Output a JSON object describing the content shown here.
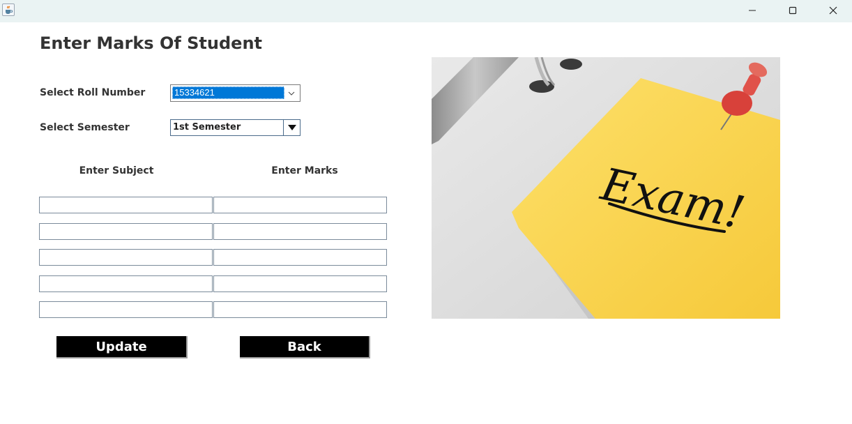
{
  "window": {
    "app_icon": "java-cup-icon",
    "controls": [
      "minimize-icon",
      "maximize-icon",
      "close-icon"
    ]
  },
  "form": {
    "title": "Enter Marks Of Student",
    "roll_label": "Select Roll Number",
    "roll_value": "15334621",
    "semester_label": "Select Semester",
    "semester_value": "1st Semester",
    "subject_header": "Enter Subject",
    "marks_header": "Enter Marks",
    "rows": [
      {
        "subject": "",
        "marks": ""
      },
      {
        "subject": "",
        "marks": ""
      },
      {
        "subject": "",
        "marks": ""
      },
      {
        "subject": "",
        "marks": ""
      },
      {
        "subject": "",
        "marks": ""
      }
    ]
  },
  "buttons": {
    "update": "Update",
    "back": "Back"
  },
  "image": {
    "note_text": "Exam!",
    "colors": {
      "note": "#fbd54a",
      "pin": "#e0453a",
      "background": "#dcdcdc"
    }
  }
}
